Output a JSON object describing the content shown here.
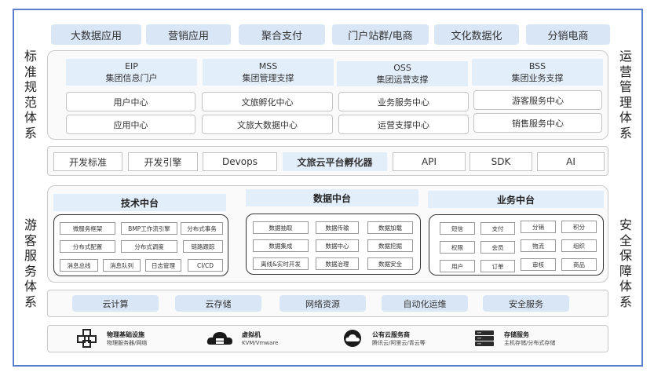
{
  "top_apps": [
    "大数据应用",
    "营销应用",
    "聚合支付",
    "门户站群/电商",
    "文化数据化",
    "分销电商"
  ],
  "left_top_label": "标\n准\n规\n范\n体\n系",
  "right_top_label": "运\n营\n管\n理\n体\n系",
  "left_bottom_label": "游\n客\n服\n务\n体\n系",
  "right_bottom_label": "安\n全\n保\n障\n体\n系",
  "suites": [
    {
      "code": "EIP",
      "name": "集团信息门户",
      "items": [
        "用户中心",
        "应用中心"
      ]
    },
    {
      "code": "MSS",
      "name": "集团管理支撑",
      "items": [
        "文旅孵化中心",
        "文旅大数据中心"
      ]
    },
    {
      "code": "OSS",
      "name": "集团运营支撑",
      "items": [
        "业务服务中心",
        "运营支撑中心"
      ]
    },
    {
      "code": "BSS",
      "name": "集团业务支撑",
      "items": [
        "游客服务中心",
        "销售服务中心"
      ]
    }
  ],
  "dev_bar": [
    "开发标准",
    "开发引擎",
    "Devops",
    "文旅云平台孵化器",
    "API",
    "SDK",
    "AI"
  ],
  "platforms": [
    {
      "title": "技术中台",
      "items": [
        "微服务框架",
        "BMP工作流引擎",
        "分布式事务",
        "分布式配置",
        "分布式调度",
        "链路跟踪",
        "消息总线",
        "消息队列",
        "日志管理",
        "CI/CD"
      ]
    },
    {
      "title": "数据中台",
      "items": [
        "数据抽取",
        "数据传输",
        "数据加载",
        "数据集成",
        "数据中心",
        "数据挖掘",
        "离线&实时开发",
        "数据治理",
        "数据安全"
      ]
    },
    {
      "title": "业务中台",
      "items": [
        "短信",
        "支付",
        "分销",
        "积分",
        "权限",
        "会员",
        "物流",
        "组织",
        "用户",
        "订单",
        "审核",
        "商品"
      ]
    }
  ],
  "cloud_bar": [
    "云计算",
    "云存储",
    "网络资源",
    "自动化运维",
    "安全服务"
  ],
  "infra": [
    {
      "icon": "cubes-icon",
      "title": "物理基础设施",
      "sub": "物理服务器/网络"
    },
    {
      "icon": "cloud-server-icon",
      "title": "虚拟机",
      "sub": "KVM/Vmware"
    },
    {
      "icon": "cloud-icon",
      "title": "公有云服务商",
      "sub": "腾讯云/阿里云/青云等"
    },
    {
      "icon": "database-icon",
      "title": "存储服务",
      "sub": "主机存储/分布式存储"
    }
  ],
  "colors": {
    "frame": "#5b7fcf",
    "pill": "#d9e6f6",
    "header": "#e3eefb"
  }
}
